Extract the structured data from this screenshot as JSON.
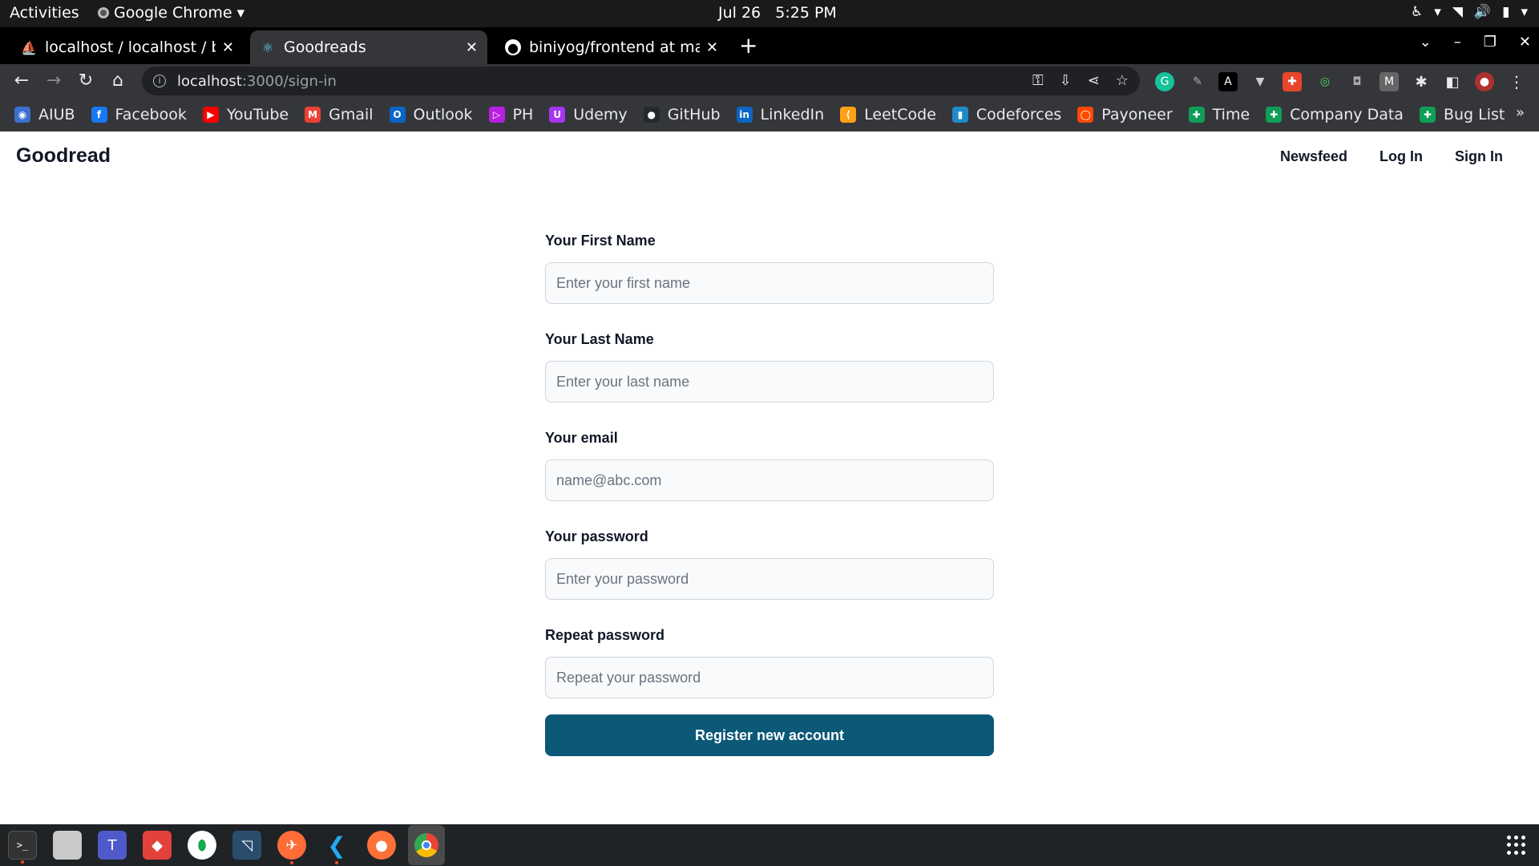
{
  "system_bar": {
    "activities": "Activities",
    "app_name": "Google Chrome",
    "date": "Jul 26",
    "time": "5:25 PM"
  },
  "tabs": [
    {
      "title": "localhost / localhost / bini",
      "favicon": "phpmyadmin-icon",
      "active": false
    },
    {
      "title": "Goodreads",
      "favicon": "react-icon",
      "active": true
    },
    {
      "title": "biniyog/frontend at main",
      "favicon": "github-icon",
      "active": false
    }
  ],
  "address_bar": {
    "host": "localhost",
    "path": ":3000/sign-in"
  },
  "bookmarks": [
    {
      "label": "AIUB",
      "icon": "aiub-icon",
      "color": "#3b6fd1"
    },
    {
      "label": "Facebook",
      "icon": "facebook-icon",
      "color": "#1877f2"
    },
    {
      "label": "YouTube",
      "icon": "youtube-icon",
      "color": "#ff0000"
    },
    {
      "label": "Gmail",
      "icon": "gmail-icon",
      "color": "#ea4335"
    },
    {
      "label": "Outlook",
      "icon": "outlook-icon",
      "color": "#0a64c8"
    },
    {
      "label": "PH",
      "icon": "ph-icon",
      "color": "#b620e0"
    },
    {
      "label": "Udemy",
      "icon": "udemy-icon",
      "color": "#a435f0"
    },
    {
      "label": "GitHub",
      "icon": "github-icon",
      "color": "#24292f"
    },
    {
      "label": "LinkedIn",
      "icon": "linkedin-icon",
      "color": "#0a66c2"
    },
    {
      "label": "LeetCode",
      "icon": "leetcode-icon",
      "color": "#ffa116"
    },
    {
      "label": "Codeforces",
      "icon": "codeforces-icon",
      "color": "#1f8acb"
    },
    {
      "label": "Payoneer",
      "icon": "payoneer-icon",
      "color": "#ff4800"
    },
    {
      "label": "Time",
      "icon": "sheets-icon",
      "color": "#0f9d58"
    },
    {
      "label": "Company Data",
      "icon": "sheets-icon",
      "color": "#0f9d58"
    },
    {
      "label": "Bug List",
      "icon": "sheets-icon",
      "color": "#0f9d58"
    }
  ],
  "site": {
    "brand": "Goodread",
    "nav": {
      "newsfeed": "Newsfeed",
      "login": "Log In",
      "signin": "Sign In"
    }
  },
  "form": {
    "first_name": {
      "label": "Your First Name",
      "placeholder": "Enter your first name",
      "value": ""
    },
    "last_name": {
      "label": "Your Last Name",
      "placeholder": "Enter your last name",
      "value": ""
    },
    "email": {
      "label": "Your email",
      "placeholder": "name@abc.com",
      "value": ""
    },
    "password": {
      "label": "Your password",
      "placeholder": "Enter your password",
      "value": ""
    },
    "repeat_password": {
      "label": "Repeat password",
      "placeholder": "Repeat your password",
      "value": ""
    },
    "submit_label": "Register new account"
  },
  "colors": {
    "primary_button": "#0b5877",
    "input_bg": "#f9fafb",
    "input_border": "#d1d5db"
  },
  "dock_apps": [
    "terminal-icon",
    "files-icon",
    "teams-icon",
    "git-icon",
    "mongodb-compass-icon",
    "mysql-workbench-icon",
    "postman-icon",
    "vscode-icon",
    "firefox-icon",
    "chrome-icon"
  ]
}
